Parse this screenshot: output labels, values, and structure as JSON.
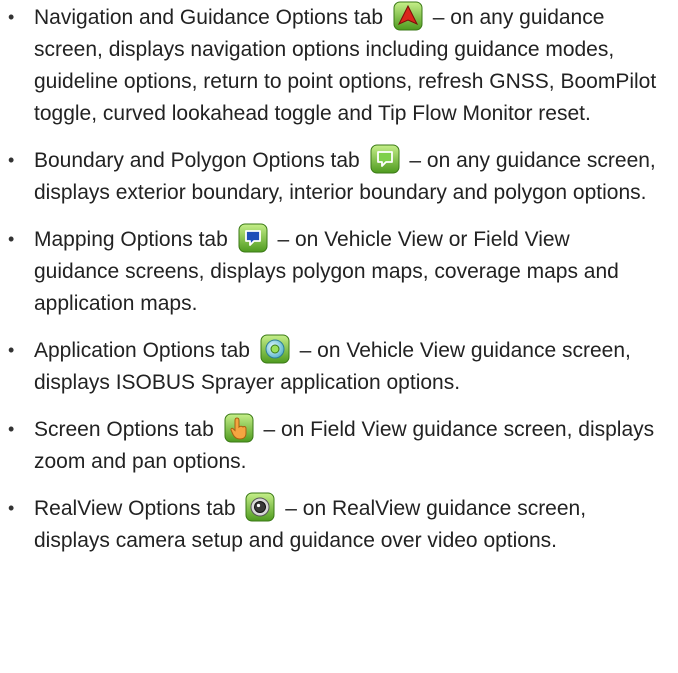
{
  "bullet_char": "•",
  "items": [
    {
      "icon": "navigation-options-icon",
      "before": "Navigation and Guidance Options tab",
      "after": "– on any guidance screen, displays navigation options including guidance modes, guideline options, return to point options, refresh GNSS, BoomPilot toggle, curved lookahead toggle and Tip Flow Monitor reset."
    },
    {
      "icon": "boundary-polygon-options-icon",
      "before": "Boundary and Polygon Options tab",
      "after": "– on any guidance screen, displays exterior boundary, interior boundary and polygon options."
    },
    {
      "icon": "mapping-options-icon",
      "before": "Mapping Options tab",
      "after": "– on Vehicle View or Field View guidance screens, displays polygon maps, coverage maps and application maps."
    },
    {
      "icon": "application-options-icon",
      "before": "Application Options tab",
      "after": "– on Vehicle View guidance screen, displays ISOBUS Sprayer application options."
    },
    {
      "icon": "screen-options-icon",
      "before": "Screen Options tab",
      "after": "– on Field View guidance screen, displays zoom and pan options."
    },
    {
      "icon": "realview-options-icon",
      "before": "RealView Options tab",
      "after": "– on RealView guidance screen, displays camera setup and guidance over video options."
    }
  ]
}
